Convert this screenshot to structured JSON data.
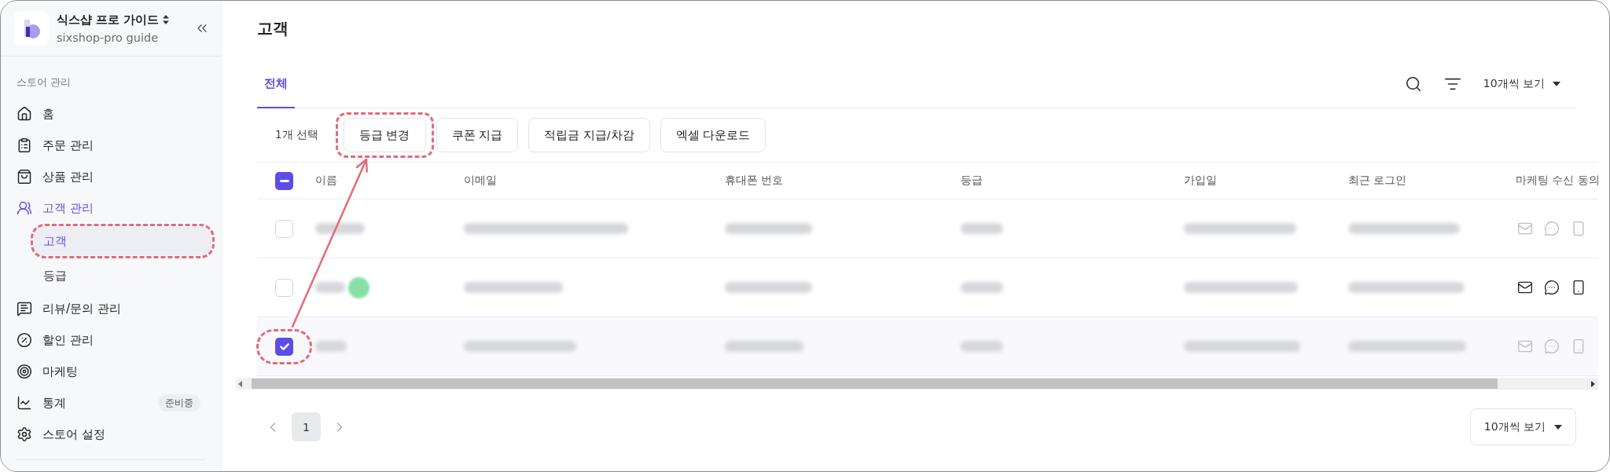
{
  "sidebar": {
    "store_name": "식스샵 프로 가이드",
    "store_subtitle": "sixshop-pro guide",
    "section_label": "스토어 관리",
    "items": [
      {
        "label": "홈",
        "selected": false
      },
      {
        "label": "주문 관리",
        "selected": false
      },
      {
        "label": "상품 관리",
        "selected": false
      },
      {
        "label": "고객 관리",
        "selected": true,
        "children": [
          {
            "label": "고객",
            "selected": true,
            "highlighted": true
          },
          {
            "label": "등급",
            "selected": false,
            "highlighted": false
          }
        ]
      },
      {
        "label": "리뷰/문의 관리",
        "selected": false
      },
      {
        "label": "할인 관리",
        "selected": false
      },
      {
        "label": "마케팅",
        "selected": false
      },
      {
        "label": "통계",
        "selected": false,
        "badge": "준비중"
      },
      {
        "label": "스토어 설정",
        "selected": false
      }
    ]
  },
  "page_title": "고객",
  "tabs": [
    {
      "label": "전체",
      "selected": true
    }
  ],
  "page_size_top": "10개씩 보기",
  "selection_count": "1개 선택",
  "actions": [
    {
      "label": "등급 변경",
      "highlighted": true
    },
    {
      "label": "쿠폰 지급",
      "highlighted": false
    },
    {
      "label": "적립금 지급/차감",
      "highlighted": false
    },
    {
      "label": "엑셀 다운로드",
      "highlighted": false
    }
  ],
  "table": {
    "header_checkbox": {
      "checked": true,
      "partial": true
    },
    "columns": [
      "이름",
      "이메일",
      "휴대폰 번호",
      "등급",
      "가입일",
      "최근 로그인",
      "마케팅 수신 동의"
    ],
    "rows": [
      {
        "selected": false,
        "highlighted": false,
        "name_badge": false,
        "consent": [
          {
            "on": false
          },
          {
            "on": false
          },
          {
            "on": false
          }
        ]
      },
      {
        "selected": false,
        "highlighted": false,
        "name_badge": true,
        "consent": [
          {
            "on": true
          },
          {
            "on": true
          },
          {
            "on": true
          }
        ]
      },
      {
        "selected": true,
        "highlighted": true,
        "name_badge": false,
        "consent": [
          {
            "on": false
          },
          {
            "on": false
          },
          {
            "on": false
          }
        ]
      }
    ]
  },
  "arrow": true,
  "pagination": {
    "pages": [
      {
        "label": "1",
        "selected": true
      }
    ],
    "page_size": "10개씩 보기"
  }
}
